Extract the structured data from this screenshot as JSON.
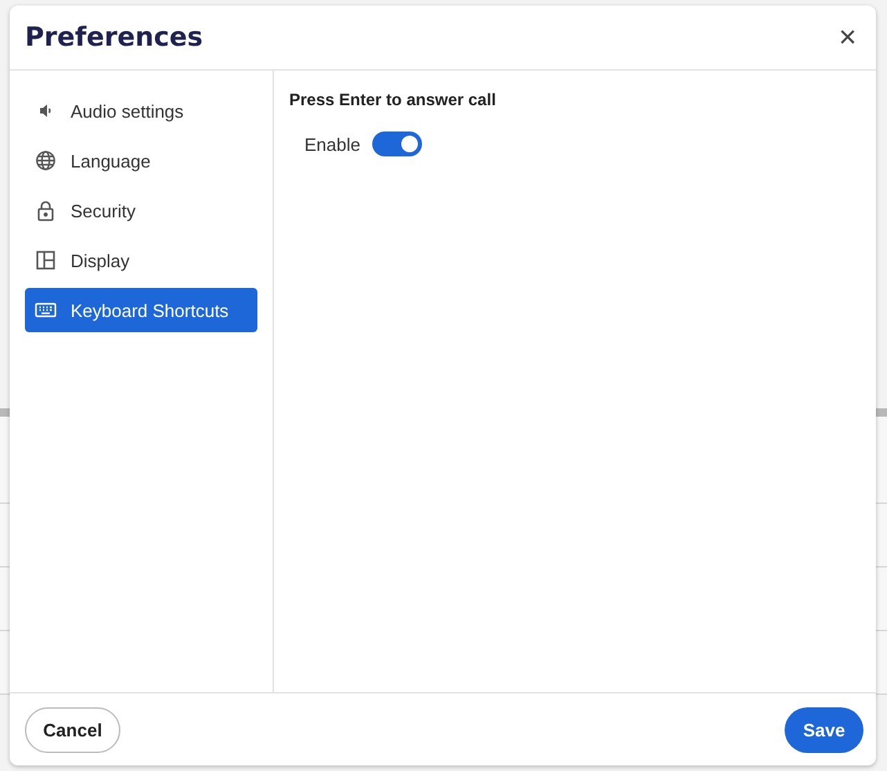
{
  "dialog": {
    "title": "Preferences",
    "close": "×"
  },
  "sidebar": {
    "items": [
      {
        "label": "Audio settings",
        "kind": "audio",
        "selected": false
      },
      {
        "label": "Language",
        "kind": "language",
        "selected": false
      },
      {
        "label": "Security",
        "kind": "security",
        "selected": false
      },
      {
        "label": "Display",
        "kind": "display",
        "selected": false
      },
      {
        "label": "Keyboard Shortcuts",
        "kind": "keyboard",
        "selected": true
      }
    ]
  },
  "content": {
    "heading": "Press Enter to answer call",
    "toggle": {
      "label": "Enable",
      "on": true
    }
  },
  "buttons": {
    "cancel": "Cancel",
    "save": "Save"
  }
}
